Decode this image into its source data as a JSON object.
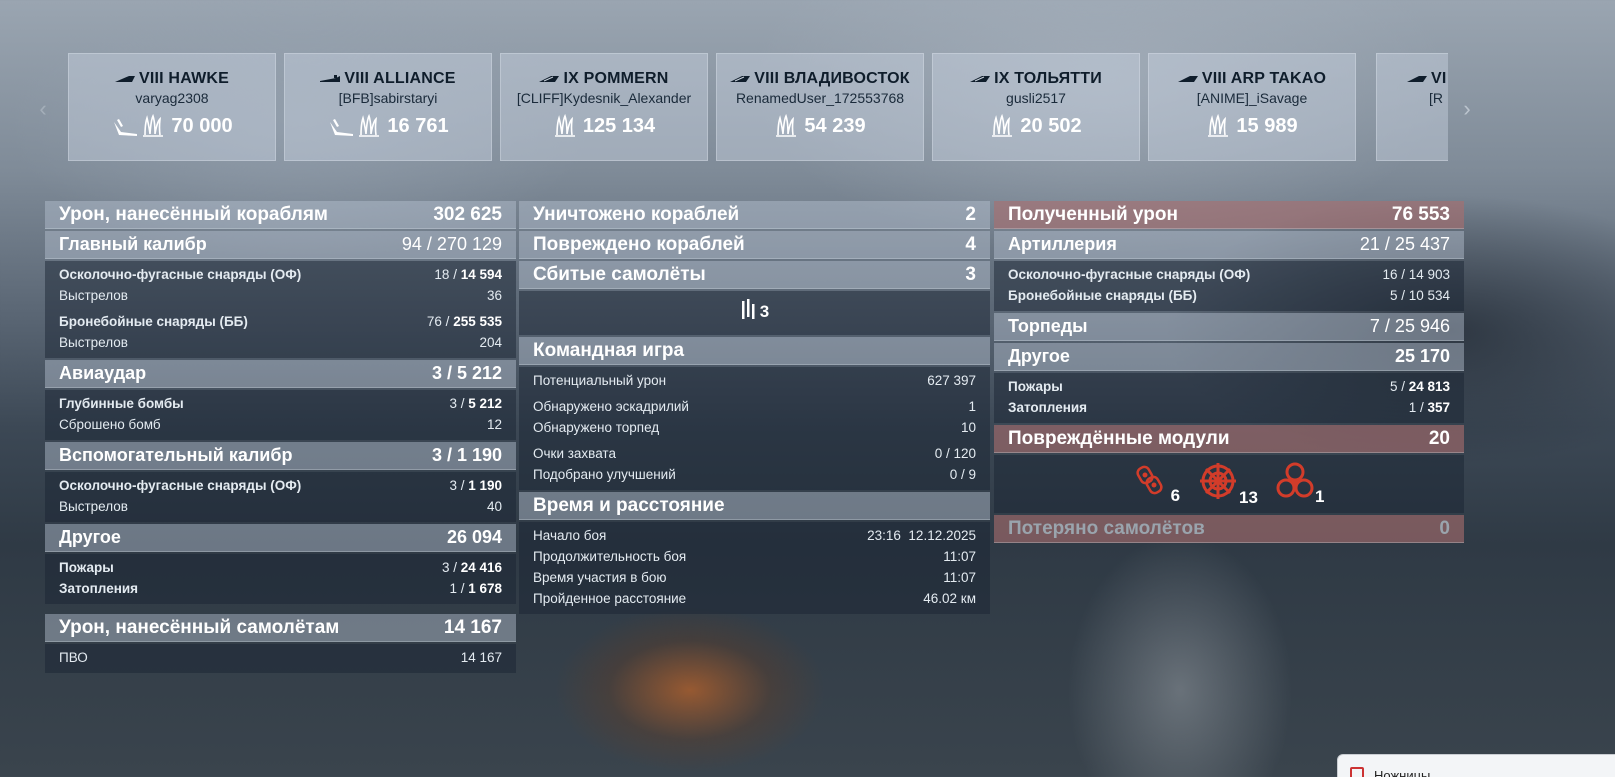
{
  "carousel": {
    "cards": [
      {
        "ship": "VIII HAWKE",
        "player": "varyag2308",
        "score": "70 000",
        "class_icon": "destroyer-icon",
        "extra_icon": "torpedo-hit-icon"
      },
      {
        "ship": "VIII ALLIANCE",
        "player": "[BFB]sabirstaryi",
        "score": "16 761",
        "class_icon": "submarine-icon",
        "extra_icon": "torpedo-hit-icon"
      },
      {
        "ship": "IX POMMERN",
        "player": "[CLIFF]Kydesnik_Alexander",
        "score": "125 134",
        "class_icon": "battleship-icon"
      },
      {
        "ship": "VIII ВЛАДИВОСТОК",
        "player": "RenamedUser_172553768",
        "score": "54 239",
        "class_icon": "battleship-icon"
      },
      {
        "ship": "IX ТОЛЬЯТТИ",
        "player": "gusli2517",
        "score": "20 502",
        "class_icon": "battleship-icon"
      },
      {
        "ship": "VIII ARP TAKAO",
        "player": "[ANIME]_iSavage",
        "score": "15 989",
        "class_icon": "cruiser-icon"
      },
      {
        "ship": "VI",
        "player": "[R",
        "score": "",
        "class_icon": "cruiser-icon"
      }
    ],
    "score_icon": "damage-burst-icon"
  },
  "left": {
    "damage_ships": {
      "label": "Урон, нанесённый кораблям",
      "value": "302 625"
    },
    "main_caliber": {
      "label": "Главный калибр",
      "value": "94 / 270 129"
    },
    "mc_he": {
      "label": "Осколочно-фугасные снаряды (ОФ)",
      "a": "18 / ",
      "b": "14 594"
    },
    "mc_he_shots": {
      "label": "Выстрелов",
      "value": "36"
    },
    "mc_ap": {
      "label": "Бронебойные снаряды (ББ)",
      "a": "76 / ",
      "b": "255 535"
    },
    "mc_ap_shots": {
      "label": "Выстрелов",
      "value": "204"
    },
    "airstrike": {
      "label": "Авиаудар",
      "value": "3 / 5 212"
    },
    "depth_charges": {
      "label": "Глубинные бомбы",
      "a": "3 / ",
      "b": "5 212"
    },
    "bombs_dropped": {
      "label": "Сброшено бомб",
      "value": "12"
    },
    "secondary": {
      "label": "Вспомогательный калибр",
      "value": "3 / 1 190"
    },
    "sec_he": {
      "label": "Осколочно-фугасные снаряды (ОФ)",
      "a": "3 / ",
      "b": "1 190"
    },
    "sec_shots": {
      "label": "Выстрелов",
      "value": "40"
    },
    "other": {
      "label": "Другое",
      "value": "26 094"
    },
    "fires": {
      "label": "Пожары",
      "a": "3 / ",
      "b": "24 416"
    },
    "floods": {
      "label": "Затопления",
      "a": "1 / ",
      "b": "1 678"
    },
    "damage_planes": {
      "label": "Урон, нанесённый самолётам",
      "value": "14 167"
    },
    "aa": {
      "label": "ПВО",
      "value": "14 167"
    }
  },
  "mid": {
    "destroyed": {
      "label": "Уничтожено кораблей",
      "value": "2"
    },
    "damaged": {
      "label": "Повреждено кораблей",
      "value": "4"
    },
    "planes_shot": {
      "label": "Сбитые самолёты",
      "value": "3"
    },
    "planes_icon_count": "3",
    "team": {
      "label": "Командная игра"
    },
    "potential": {
      "label": "Потенциальный урон",
      "value": "627 397"
    },
    "spotted_squadrons": {
      "label": "Обнаружено эскадрилий",
      "value": "1"
    },
    "spotted_torps": {
      "label": "Обнаружено торпед",
      "value": "10"
    },
    "capture": {
      "label": "Очки захвата",
      "value": "0 / 120"
    },
    "upgrades": {
      "label": "Подобрано улучшений",
      "value": "0 / 9"
    },
    "time": {
      "label": "Время и расстояние"
    },
    "start": {
      "label": "Начало боя",
      "value": "23:16  12.12.2025"
    },
    "duration": {
      "label": "Продолжительность боя",
      "value": "11:07"
    },
    "in_battle": {
      "label": "Время участия в бою",
      "value": "11:07"
    },
    "distance": {
      "label": "Пройденное расстояние",
      "value": "46.02 км"
    }
  },
  "right": {
    "received": {
      "label": "Полученный урон",
      "value": "76 553"
    },
    "artillery": {
      "label": "Артиллерия",
      "value": "21 / 25 437"
    },
    "r_he": {
      "label": "Осколочно-фугасные снаряды (ОФ)",
      "value": "16 / 14 903"
    },
    "r_ap": {
      "label": "Бронебойные снаряды (ББ)",
      "value": "5 / 10 534"
    },
    "torpedoes": {
      "label": "Торпеды",
      "value": "7 / 25 946"
    },
    "other": {
      "label": "Другое",
      "value": "25 170"
    },
    "fires": {
      "label": "Пожары",
      "a": "5 / ",
      "b": "24 813"
    },
    "floods": {
      "label": "Затопления",
      "a": "1 / ",
      "b": "357"
    },
    "modules": {
      "label": "Повреждённые модули",
      "value": "20"
    },
    "module_icons": [
      {
        "icon": "engine-icon",
        "count": "6"
      },
      {
        "icon": "steering-icon",
        "count": "13"
      },
      {
        "icon": "propeller-icon",
        "count": "1"
      }
    ],
    "planes_lost": {
      "label": "Потеряно самолётов",
      "value": "0"
    }
  },
  "toast": {
    "text": "Ножницы"
  },
  "colors": {
    "header_red": "#aa6e6e",
    "module_icon_red": "#d23c2a"
  }
}
